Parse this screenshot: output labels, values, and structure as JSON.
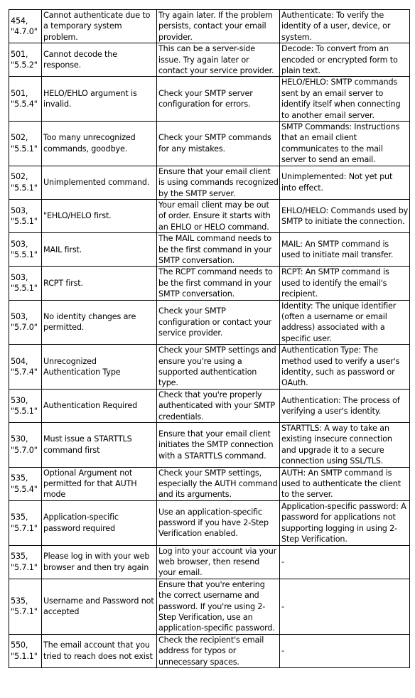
{
  "table": {
    "rows": [
      {
        "code": "454,",
        "enhanced": "\"4.7.0\"",
        "description": "Cannot authenticate due to a temporary system problem.",
        "solution": "Try again later. If the problem persists, contact your email provider.",
        "definition": "Authenticate: To verify the identity of a user, device, or system."
      },
      {
        "code": "501,",
        "enhanced": "\"5.5.2\"",
        "description": "Cannot decode the response.",
        "solution": "This can be a server-side issue. Try again later or contact your service provider.",
        "definition": "Decode: To convert from an encoded or encrypted form to plain text."
      },
      {
        "code": "501,",
        "enhanced": "\"5.5.4\"",
        "description": "HELO/EHLO argument is invalid.",
        "solution": "Check your SMTP server configuration for errors.",
        "definition": "HELO/EHLO: SMTP commands sent by an email server to identify itself when connecting to another email server."
      },
      {
        "code": "502,",
        "enhanced": "\"5.5.1\"",
        "description": "Too many unrecognized commands, goodbye.",
        "solution": "Check your SMTP commands for any mistakes.",
        "definition": "SMTP Commands: Instructions that an email client communicates to the mail server to send an email."
      },
      {
        "code": "502,",
        "enhanced": "\"5.5.1\"",
        "description": "Unimplemented command.",
        "solution": "Ensure that your email client is using commands recognized by the SMTP server.",
        "definition": "Unimplemented: Not yet put into effect."
      },
      {
        "code": "503,",
        "enhanced": "\"5.5.1\"",
        "description": "\"EHLO/HELO first.",
        "solution": "Your email client may be out of order. Ensure it starts with an EHLO or HELO command.",
        "definition": "EHLO/HELO: Commands used by SMTP to initiate the connection."
      },
      {
        "code": "503,",
        "enhanced": "\"5.5.1\"",
        "description": "MAIL first.",
        "solution": "The MAIL command needs to be the first command in your SMTP conversation.",
        "definition": "MAIL: An SMTP command is used to initiate mail transfer."
      },
      {
        "code": "503,",
        "enhanced": "\"5.5.1\"",
        "description": "RCPT first.",
        "solution": "The RCPT command needs to be the first command in your SMTP conversation.",
        "definition": "RCPT: An SMTP command is used to identify the email's recipient."
      },
      {
        "code": "503,",
        "enhanced": "\"5.7.0\"",
        "description": "No identity changes are permitted.",
        "solution": "Check your SMTP configuration or contact your service provider.",
        "definition": "Identity: The unique identifier (often a username or email address) associated with a specific user."
      },
      {
        "code": "504,",
        "enhanced": "\"5.7.4\"",
        "description": "Unrecognized Authentication Type",
        "solution": "Check your SMTP settings and ensure you're using a supported authentication type.",
        "definition": "Authentication Type: The method used to verify a user's identity, such as password or OAuth."
      },
      {
        "code": "530,",
        "enhanced": "\"5.5.1\"",
        "description": "Authentication Required",
        "solution": "Check that you're properly authenticated with your SMTP credentials.",
        "definition": "Authentication: The process of verifying a user's identity."
      },
      {
        "code": "530,",
        "enhanced": "\"5.7.0\"",
        "description": "Must issue a STARTTLS command first",
        "solution": "Ensure that your email client initiates the SMTP connection with a STARTTLS command.",
        "definition": "STARTTLS: A way to take an existing insecure connection and upgrade it to a secure connection using SSL/TLS."
      },
      {
        "code": "535,",
        "enhanced": "\"5.5.4\"",
        "description": "Optional Argument not permitted for that AUTH mode",
        "solution": "Check your SMTP settings, especially the AUTH command and its arguments.",
        "definition": "AUTH: An SMTP command is used to authenticate the client to the server."
      },
      {
        "code": "535,",
        "enhanced": "\"5.7.1\"",
        "description": "Application-specific password required",
        "solution": "Use an application-specific password if you have 2-Step Verification enabled.",
        "definition": "Application-specific password: A password for applications not supporting logging in using 2-Step Verification."
      },
      {
        "code": "535,",
        "enhanced": "\"5.7.1\"",
        "description": "Please log in with your web browser and then try again",
        "solution": "Log into your account via your web browser, then resend your email.",
        "definition": "-"
      },
      {
        "code": "535,",
        "enhanced": "\"5.7.1\"",
        "description": "Username and Password not accepted",
        "solution": "Ensure that you're entering the correct username and password. If you're using 2-Step Verification, use an application-specific password.",
        "definition": "-"
      },
      {
        "code": "550,",
        "enhanced": "\"5.1.1\"",
        "description": "The email account that you tried to reach does not exist",
        "solution": "Check the recipient's email address for typos or unnecessary spaces.",
        "definition": "-"
      }
    ]
  }
}
